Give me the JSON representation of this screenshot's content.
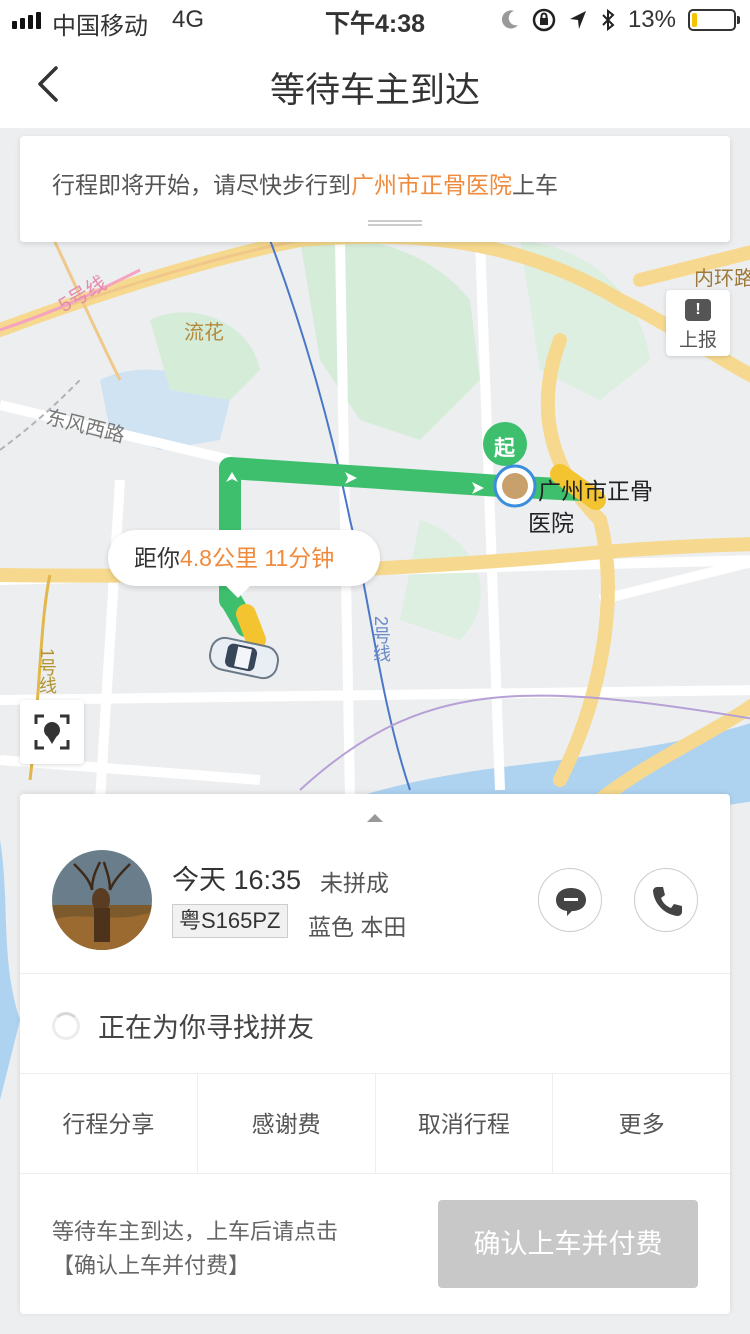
{
  "status_bar": {
    "carrier": "中国移动",
    "network": "4G",
    "time": "下午4:38",
    "battery": "13%",
    "battery_level": 0.13
  },
  "nav": {
    "title": "等待车主到达",
    "back_icon": "chevron-left-icon"
  },
  "notice": {
    "prefix": "行程即将开始，请尽快步行到",
    "place": "广州市正骨医院",
    "suffix": "上车"
  },
  "map": {
    "labels": {
      "line5": "5号线",
      "liuhua": "流花",
      "dongfeng": "东风西路",
      "neihuan": "内环路",
      "line2": "2号线",
      "line1": "1号线",
      "start_badge": "起",
      "dest_line1": "广州市正骨",
      "dest_line2": "医院"
    },
    "report_label": "上报",
    "distance_prefix": "距你",
    "distance_value": "4.8公里 11分钟"
  },
  "driver": {
    "time": "今天 16:35",
    "pool_status": "未拼成",
    "plate": "粤S165PZ",
    "car": "蓝色 本田"
  },
  "pool": {
    "text": "正在为你寻找拼友"
  },
  "actions": [
    {
      "label": "行程分享"
    },
    {
      "label": "感谢费"
    },
    {
      "label": "取消行程"
    },
    {
      "label": "更多"
    }
  ],
  "footer": {
    "hint_line1": "等待车主到达，上车后请点击",
    "hint_line2": "【确认上车并付费】",
    "confirm_label": "确认上车并付费"
  },
  "colors": {
    "accent": "#f08a3c",
    "route": "#3dbf6e",
    "confirm_disabled": "#c8c8c8"
  }
}
